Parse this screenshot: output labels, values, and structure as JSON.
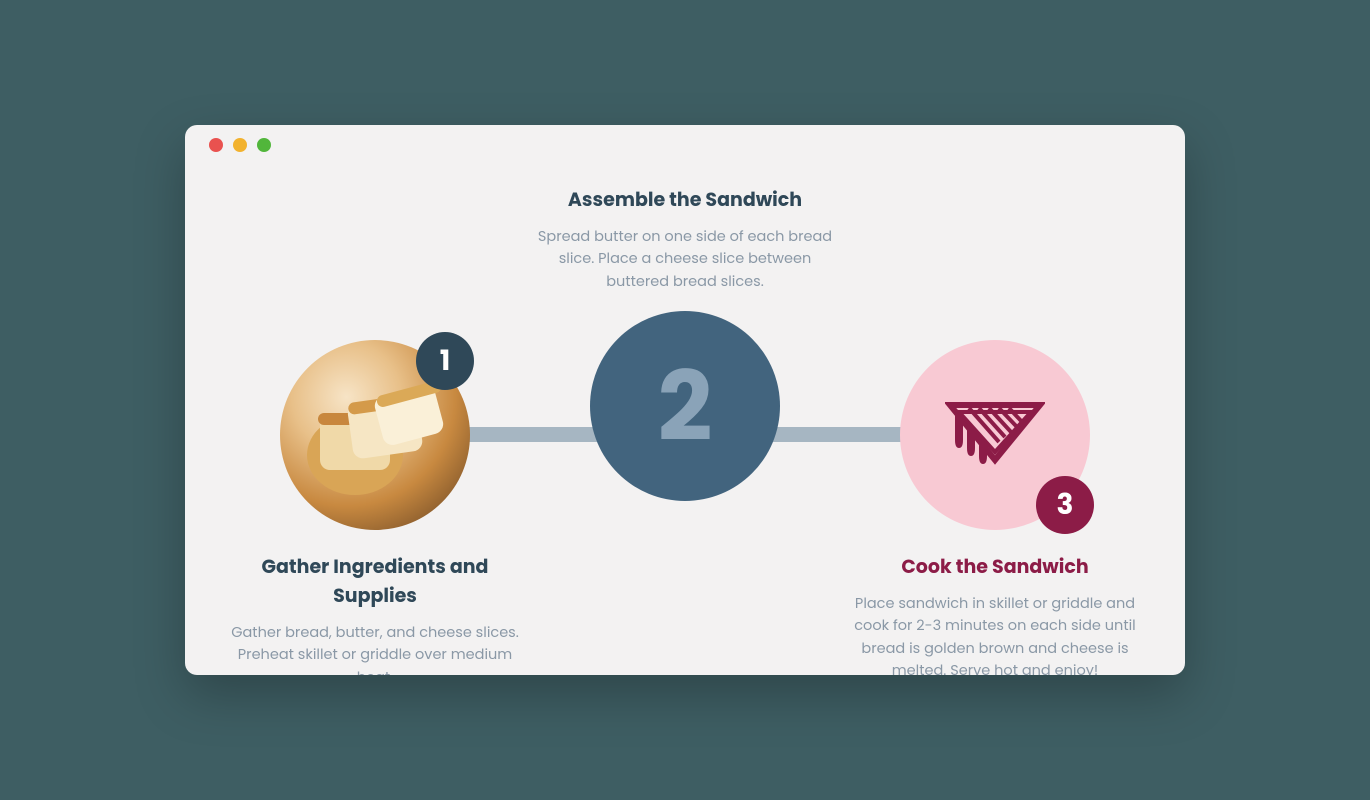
{
  "steps": [
    {
      "badge": "1",
      "title": "Gather Ingredients and Supplies",
      "desc": "Gather bread, butter, and cheese slices. Preheat skillet or griddle over medium heat."
    },
    {
      "badge": "2",
      "title": "Assemble the Sandwich",
      "desc": "Spread butter on one side of each bread slice. Place a cheese slice between buttered bread slices."
    },
    {
      "badge": "3",
      "title": "Cook the Sandwich",
      "desc": "Place sandwich in skillet or griddle and cook for 2-3 minutes on each side until bread is golden brown and cheese is melted. Serve hot and enjoy!"
    }
  ]
}
